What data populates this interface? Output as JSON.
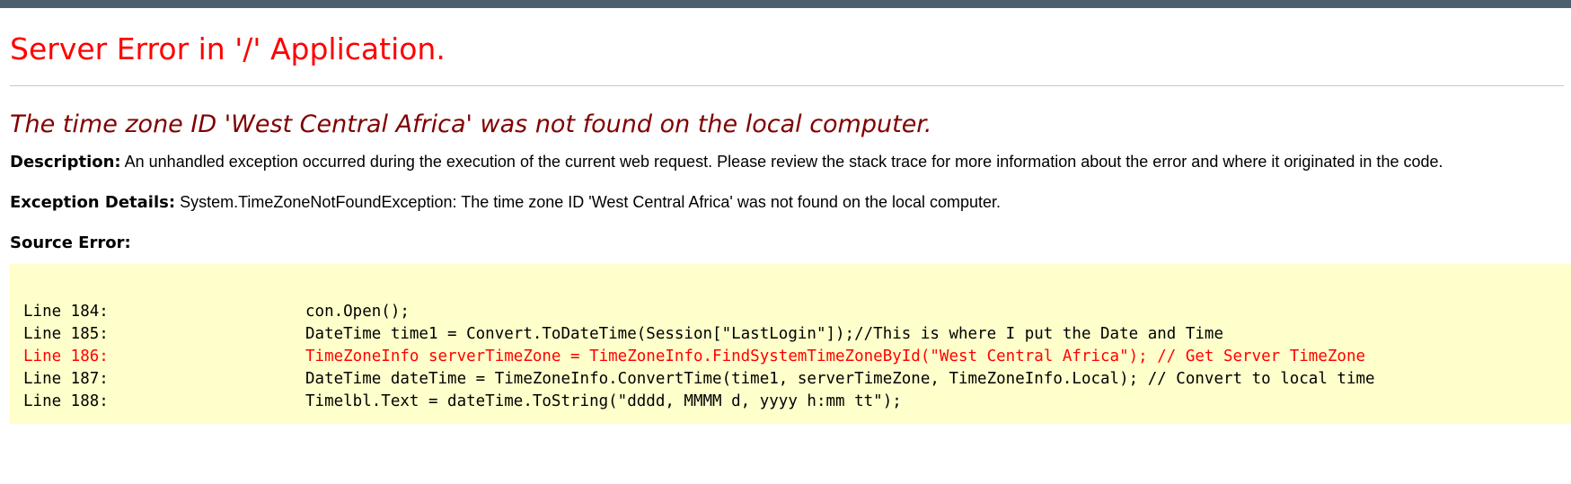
{
  "page": {
    "title": "Server Error in '/' Application.",
    "error_message": "The time zone ID 'West Central Africa' was not found on the local computer."
  },
  "description": {
    "label": "Description:",
    "text": "An unhandled exception occurred during the execution of the current web request. Please review the stack trace for more information about the error and where it originated in the code."
  },
  "exception_details": {
    "label": "Exception Details:",
    "text": "System.TimeZoneNotFoundException: The time zone ID 'West Central Africa' was not found on the local computer."
  },
  "source_error": {
    "label": "Source Error:",
    "lines": [
      {
        "line_label": "Line 184:",
        "code": "con.Open();",
        "highlighted": false
      },
      {
        "line_label": "Line 185:",
        "code": "DateTime time1 = Convert.ToDateTime(Session[\"LastLogin\"]);//This is where I put the Date and Time",
        "highlighted": false
      },
      {
        "line_label": "Line 186:",
        "code": "TimeZoneInfo serverTimeZone = TimeZoneInfo.FindSystemTimeZoneById(\"West Central Africa\"); // Get Server TimeZone",
        "highlighted": true
      },
      {
        "line_label": "Line 187:",
        "code": "DateTime dateTime = TimeZoneInfo.ConvertTime(time1, serverTimeZone, TimeZoneInfo.Local); // Convert to local time",
        "highlighted": false
      },
      {
        "line_label": "Line 188:",
        "code": "Timelbl.Text = dateTime.ToString(\"dddd, MMMM d, yyyy h:mm tt\");",
        "highlighted": false
      }
    ]
  },
  "colors": {
    "top_bar": "#4d5f6f",
    "title": "#ff0000",
    "error_message": "#800000",
    "code_background": "#ffffcc",
    "highlighted_line": "#ff0000"
  }
}
